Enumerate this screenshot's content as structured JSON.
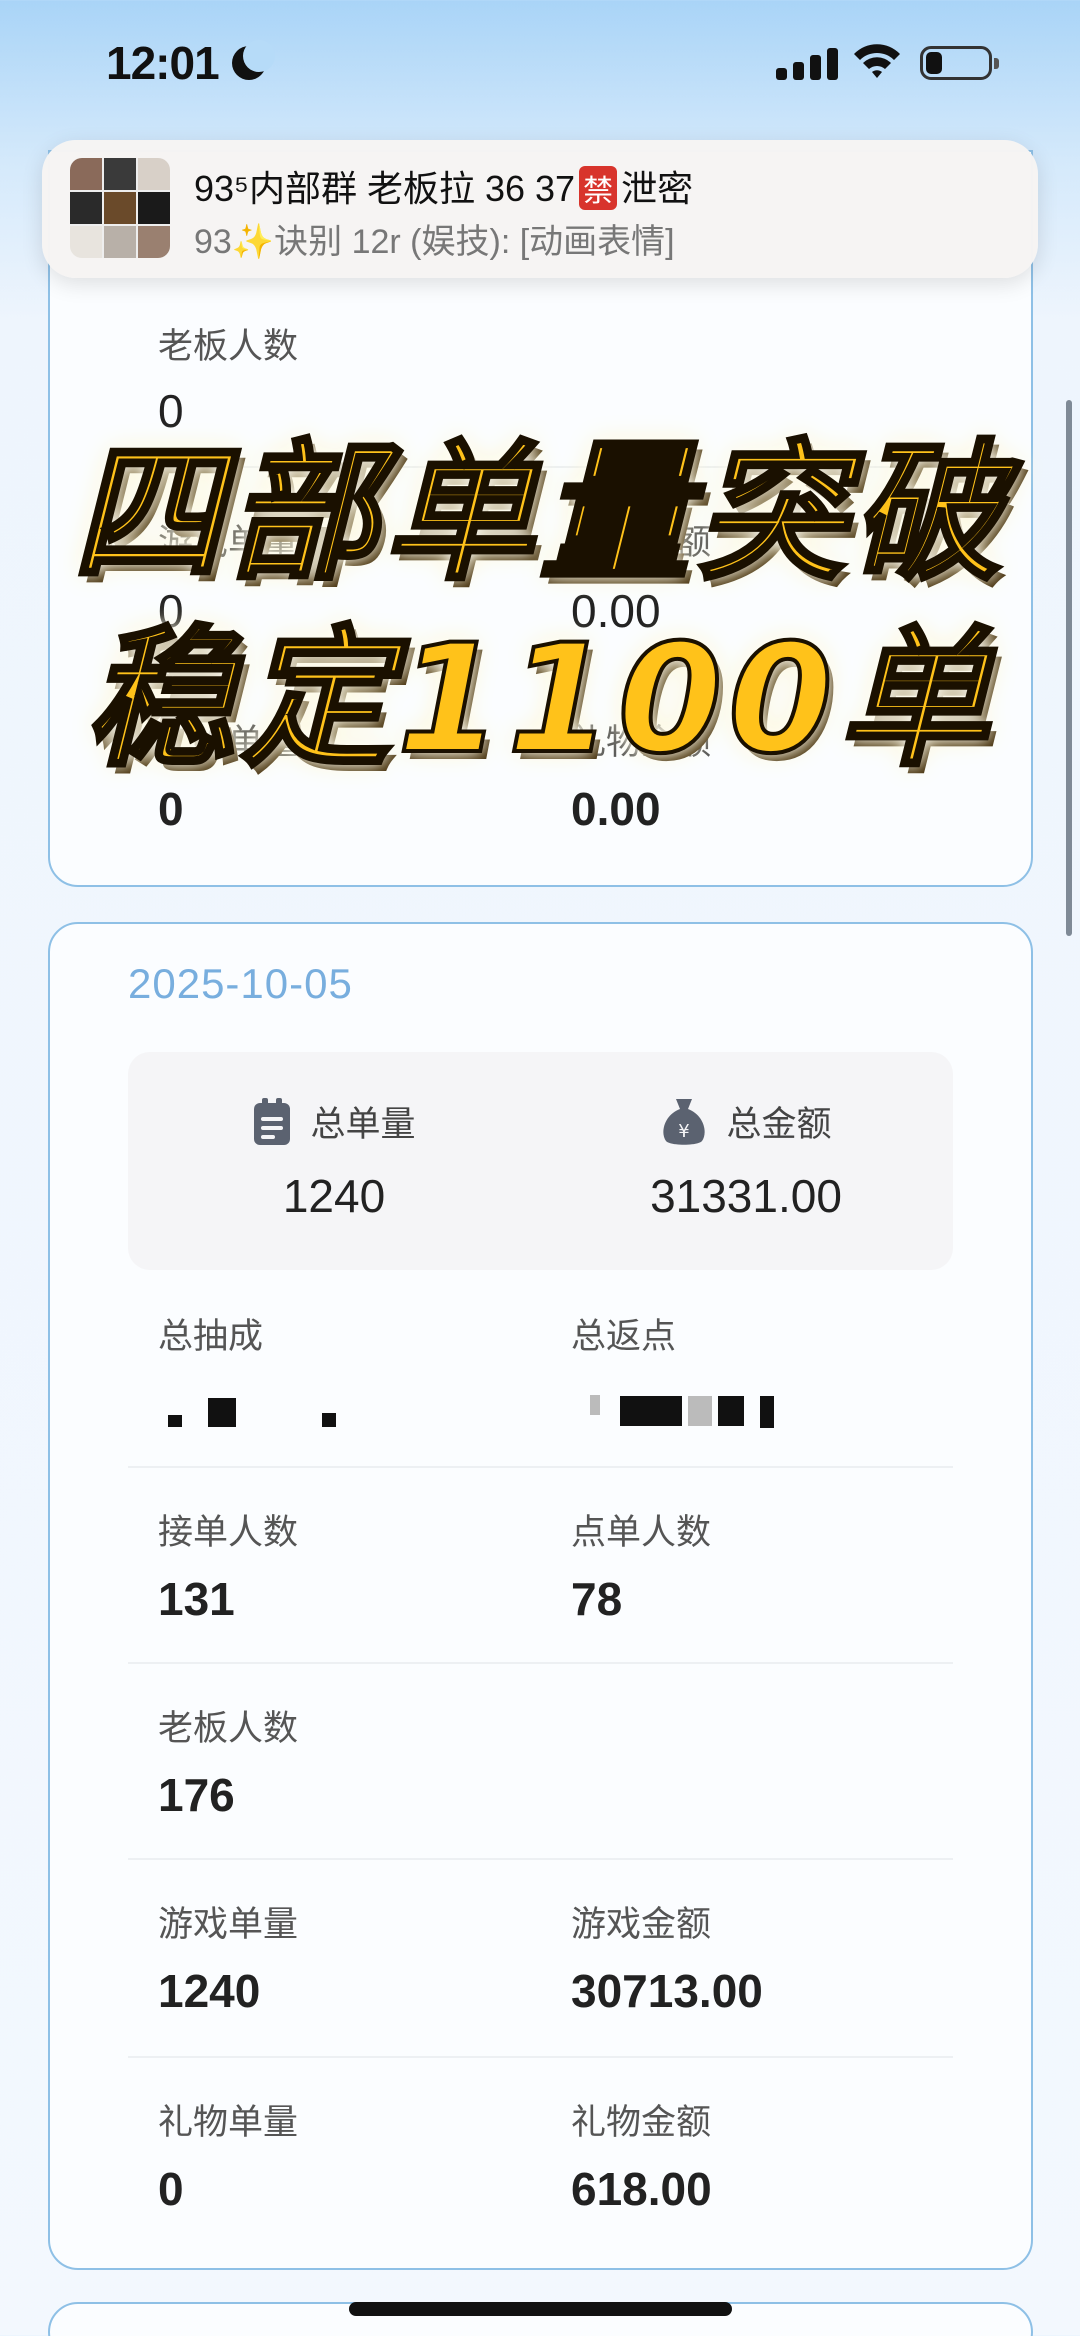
{
  "status_bar": {
    "time": "12:01"
  },
  "notification": {
    "title_prefix": "93⁵内部群 老板拉 36 37",
    "title_badge": "禁",
    "title_suffix": "泄密",
    "subtitle": "93✨诀别 12r (娱技): [动画表情]"
  },
  "promo": {
    "line1": "四部单量突破",
    "line2": "稳定1100单"
  },
  "card_prev": {
    "boss_count_label": "老板人数",
    "boss_count": "0",
    "game_orders_label": "游戏单量",
    "game_orders": "0",
    "game_amount_label": "游戏金额",
    "game_amount": "0.00",
    "gift_orders_label": "礼物单量",
    "gift_orders": "0",
    "gift_amount_label": "礼物金额",
    "gift_amount": "0.00"
  },
  "card_day": {
    "date": "2025-10-05",
    "total_orders_label": "总单量",
    "total_orders": "1240",
    "total_amount_label": "总金额",
    "total_amount": "31331.00",
    "commission_label": "总抽成",
    "rebate_label": "总返点",
    "takers_label": "接单人数",
    "takers": "131",
    "orderers_label": "点单人数",
    "orderers": "78",
    "boss_count_label": "老板人数",
    "boss_count": "176",
    "game_orders_label": "游戏单量",
    "game_orders": "1240",
    "game_amount_label": "游戏金额",
    "game_amount": "30713.00",
    "gift_orders_label": "礼物单量",
    "gift_orders": "0",
    "gift_amount_label": "礼物金额",
    "gift_amount": "618.00"
  },
  "icons": {
    "calendar": "clipboard-icon",
    "money": "money-bag-icon",
    "accent": "#78aede",
    "badge_red": "#d8342c",
    "promo_yellow": "#ffc21a"
  }
}
